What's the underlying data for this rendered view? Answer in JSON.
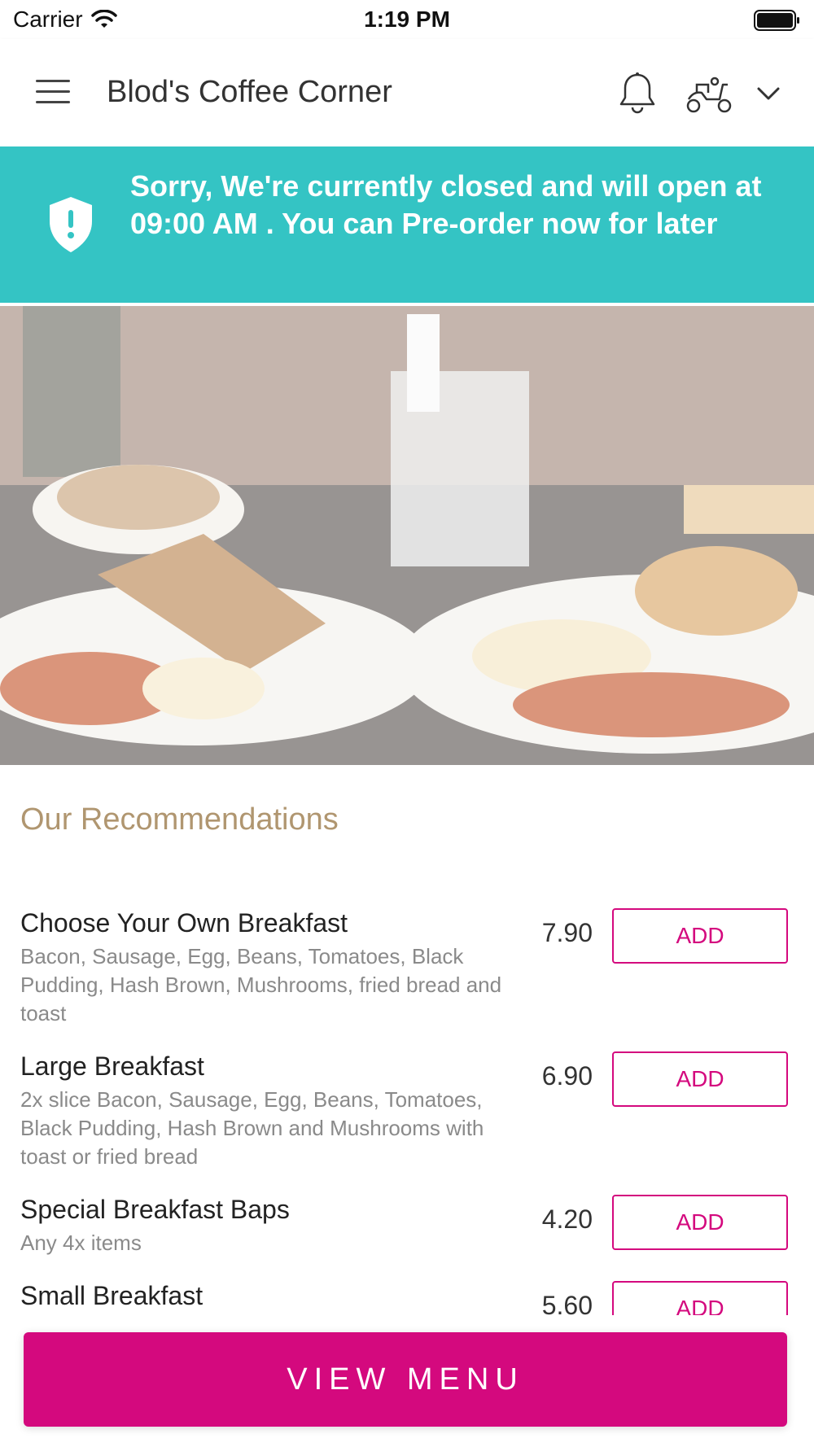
{
  "status_bar": {
    "carrier": "Carrier",
    "time": "1:19 PM"
  },
  "header": {
    "title": "Blod's Coffee Corner"
  },
  "banner": {
    "message": "Sorry, We're currently closed and will open at 09:00 AM . You can Pre-order now for later"
  },
  "recommendations": {
    "title": "Our Recommendations",
    "items": [
      {
        "name": "Choose Your Own Breakfast",
        "description": "Bacon, Sausage, Egg, Beans, Tomatoes, Black Pudding, Hash Brown, Mushrooms, fried bread and toast",
        "price": "7.90",
        "add_label": "ADD"
      },
      {
        "name": "Large Breakfast",
        "description": "2x slice Bacon, Sausage, Egg, Beans, Tomatoes, Black Pudding, Hash Brown and Mushrooms with toast or fried bread",
        "price": "6.90",
        "add_label": "ADD"
      },
      {
        "name": "Special Breakfast Baps",
        "description": "Any 4x items",
        "price": "4.20",
        "add_label": "ADD"
      },
      {
        "name": "Small Breakfast",
        "description": "",
        "price": "5.60",
        "add_label": "ADD"
      }
    ]
  },
  "footer": {
    "view_menu_label": "VIEW MENU"
  },
  "colors": {
    "banner": "#34c4c4",
    "accent": "#d4097e",
    "section_title": "#b09670"
  }
}
